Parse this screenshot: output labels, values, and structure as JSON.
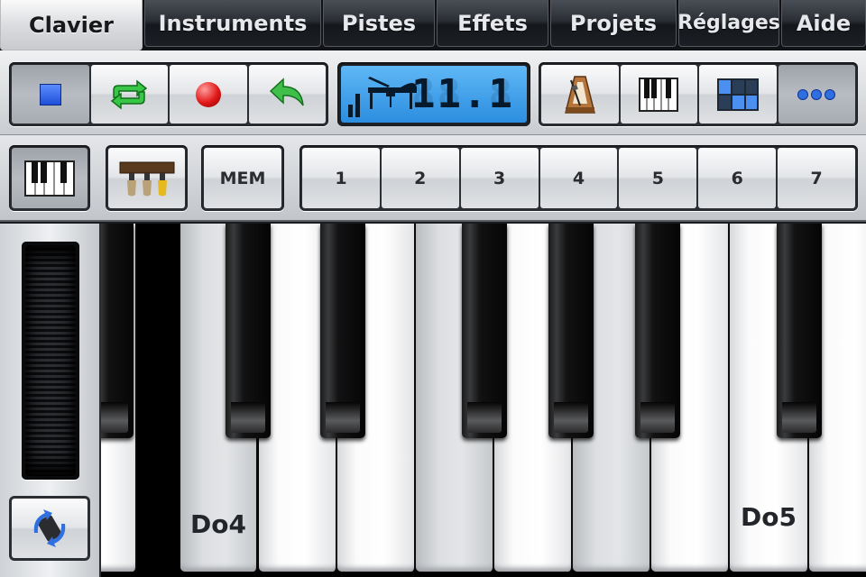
{
  "tabs": [
    {
      "label": "Clavier",
      "active": true
    },
    {
      "label": "Instruments",
      "active": false
    },
    {
      "label": "Pistes",
      "active": false
    },
    {
      "label": "Effets",
      "active": false
    },
    {
      "label": "Projets",
      "active": false
    },
    {
      "label": "Réglages",
      "active": false
    },
    {
      "label": "Aide",
      "active": false
    }
  ],
  "transport": {
    "stop_icon": "stop-icon",
    "loop_icon": "loop-icon",
    "record_icon": "record-icon",
    "undo_icon": "undo-icon"
  },
  "lcd": {
    "instrument_icon": "grand-piano-icon",
    "value": "11.1",
    "ghost": "88.8"
  },
  "tools": {
    "metronome_icon": "metronome-icon",
    "keyboard_icon": "keyboard-icon",
    "grid_icon": "grid-icon",
    "more_icon": "more-dots-icon"
  },
  "row2": {
    "keyboard_toggle_icon": "keyboard-icon",
    "pedals_icon": "pedals-icon",
    "mem_label": "MEM",
    "presets": [
      "1",
      "2",
      "3",
      "4",
      "5",
      "6",
      "7"
    ]
  },
  "side": {
    "wheel_icon": "pitch-wheel",
    "rotate_icon": "rotate-device-icon"
  },
  "keyboard": {
    "labels": {
      "do4": "Do4",
      "do5": "Do5"
    }
  },
  "colors": {
    "lcd": "#2c8ee0",
    "loop_green": "#2fb33a",
    "record_red": "#e01818",
    "stop_blue": "#1f4fd8"
  }
}
